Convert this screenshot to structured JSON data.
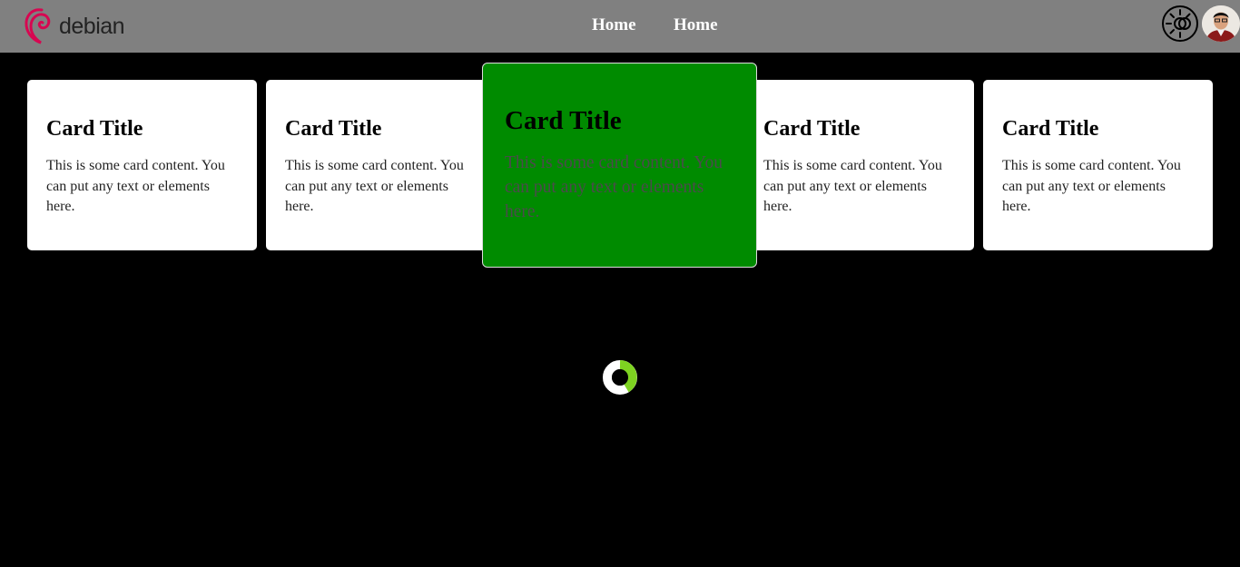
{
  "brand": {
    "name": "debian",
    "swirl_color": "#d70751"
  },
  "nav": {
    "links": [
      {
        "label": "Home"
      },
      {
        "label": "Home"
      }
    ]
  },
  "header": {
    "theme_toggle_icon": "theme-toggle-icon",
    "avatar_icon": "user-avatar"
  },
  "cards": [
    {
      "title": "Card Title",
      "content": "This is some card content. You can put any text or elements here."
    },
    {
      "title": "Card Title",
      "content": "This is some card content. You can put any text or elements here."
    },
    {
      "title": "Card Title",
      "content": "This is some card content. You can put any text or elements here."
    },
    {
      "title": "Card Title",
      "content": "This is some card content. You can put any text or elements here."
    },
    {
      "title": "Card Title",
      "content": "This is some card content. You can put any text or elements here."
    }
  ],
  "active_card_index": 2,
  "colors": {
    "navbar": "#808080",
    "background": "#000000",
    "active_card": "#008b00",
    "spinner_accent": "#7ed321"
  },
  "loader": {
    "icon": "loading-spinner-icon"
  }
}
